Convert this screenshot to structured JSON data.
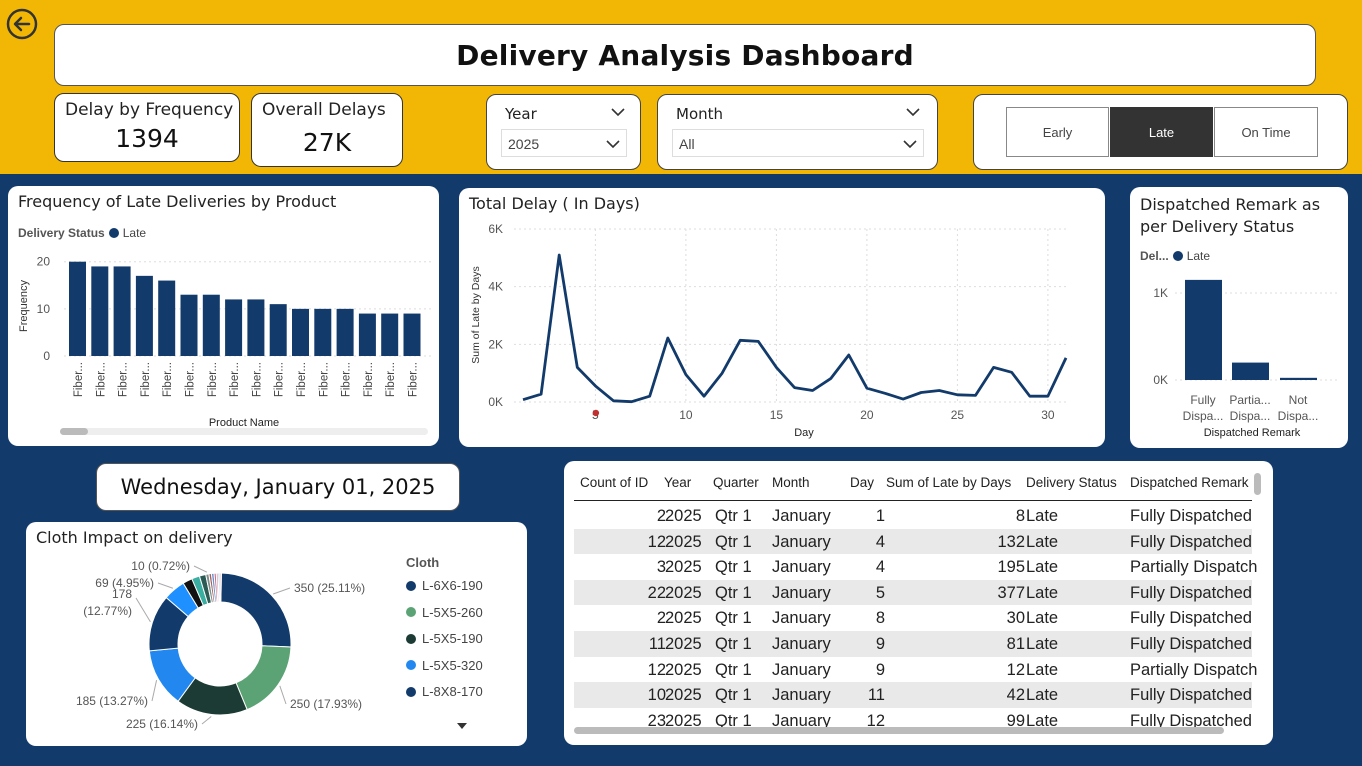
{
  "header": {
    "title": "Delivery Analysis Dashboard"
  },
  "kpis": [
    {
      "label": "Delay by Frequency",
      "value": "1394"
    },
    {
      "label": "Overall Delays",
      "value": "27K"
    }
  ],
  "filters": {
    "year": {
      "label": "Year",
      "value": "2025"
    },
    "month": {
      "label": "Month",
      "value": "All"
    }
  },
  "status_toggle": {
    "options": [
      "Early",
      "Late",
      "On Time"
    ],
    "selected": "Late"
  },
  "colors": {
    "header_bg": "#f2b705",
    "page_bg": "#123a6b",
    "series": "#123a6b",
    "active_toggle": "#333333"
  },
  "freq_chart": {
    "title": "Frequency of Late Deliveries by Product",
    "legend_title": "Delivery Status",
    "legend_item": "Late",
    "xlabel": "Product Name",
    "ylabel": "Frequency"
  },
  "delay_chart": {
    "title": "Total Delay ( In Days)",
    "xlabel": "Day",
    "ylabel": "Sum of Late by Days"
  },
  "remark_chart": {
    "title_line1": "Dispatched Remark as",
    "title_line2": "per Delivery Status",
    "legend_title": "Del...",
    "legend_item": "Late",
    "xlabel": "Dispatched Remark"
  },
  "date_display": "Wednesday, January 01, 2025",
  "cloth_chart": {
    "title": "Cloth Impact on delivery",
    "legend_title": "Cloth",
    "legend": [
      {
        "name": "L-6X6-190",
        "color": "#123a6b"
      },
      {
        "name": "L-5X5-260",
        "color": "#5ba374"
      },
      {
        "name": "L-5X5-190",
        "color": "#1c3b34"
      },
      {
        "name": "L-5X5-320",
        "color": "#2288f0"
      },
      {
        "name": "L-8X8-170",
        "color": "#123a6b"
      }
    ]
  },
  "table": {
    "columns": [
      "Count of ID",
      "Year",
      "Quarter",
      "Month",
      "Day",
      "Sum of Late by Days",
      "Delivery Status",
      "Dispatched Remark"
    ],
    "rows": [
      [
        "2",
        "2025",
        "Qtr 1",
        "January",
        "1",
        "8",
        "Late",
        "Fully Dispatched"
      ],
      [
        "12",
        "2025",
        "Qtr 1",
        "January",
        "4",
        "132",
        "Late",
        "Fully Dispatched"
      ],
      [
        "3",
        "2025",
        "Qtr 1",
        "January",
        "4",
        "195",
        "Late",
        "Partially Dispatch"
      ],
      [
        "22",
        "2025",
        "Qtr 1",
        "January",
        "5",
        "377",
        "Late",
        "Fully Dispatched"
      ],
      [
        "2",
        "2025",
        "Qtr 1",
        "January",
        "8",
        "30",
        "Late",
        "Fully Dispatched"
      ],
      [
        "11",
        "2025",
        "Qtr 1",
        "January",
        "9",
        "81",
        "Late",
        "Fully Dispatched"
      ],
      [
        "12",
        "2025",
        "Qtr 1",
        "January",
        "9",
        "12",
        "Late",
        "Partially Dispatch"
      ],
      [
        "10",
        "2025",
        "Qtr 1",
        "January",
        "11",
        "42",
        "Late",
        "Fully Dispatched"
      ],
      [
        "23",
        "2025",
        "Qtr 1",
        "January",
        "12",
        "99",
        "Late",
        "Fully Dispatched"
      ]
    ]
  },
  "chart_data": [
    {
      "type": "bar",
      "title": "Frequency of Late Deliveries by Product",
      "xlabel": "Product Name",
      "ylabel": "Frequency",
      "ylim": [
        0,
        21
      ],
      "yticks": [
        "0",
        "10",
        "20"
      ],
      "categories": [
        "Fiber...",
        "Fiber...",
        "Fiber...",
        "Fiber...",
        "Fiber...",
        "Fiber...",
        "Fiber...",
        "Fiber...",
        "Fiber...",
        "Fiber...",
        "Fiber...",
        "Fiber...",
        "Fiber...",
        "Fiber...",
        "Fiber...",
        "Fiber...",
        "Fiber..."
      ],
      "series": [
        {
          "name": "Late",
          "values": [
            20,
            19,
            19,
            17,
            16,
            13,
            13,
            12,
            12,
            11,
            10,
            10,
            10,
            9,
            9,
            9,
            0
          ]
        }
      ]
    },
    {
      "type": "line",
      "title": "Total Delay ( In Days)",
      "xlabel": "Day",
      "ylabel": "Sum of Late by Days",
      "ylim": [
        0,
        6000
      ],
      "yticks": [
        "0K",
        "2K",
        "4K",
        "6K"
      ],
      "xticks": [
        "5",
        "10",
        "15",
        "20",
        "25",
        "30"
      ],
      "x": [
        1,
        2,
        3,
        4,
        5,
        6,
        7,
        8,
        9,
        10,
        11,
        12,
        13,
        14,
        15,
        16,
        17,
        18,
        19,
        20,
        21,
        22,
        23,
        24,
        25,
        26,
        27,
        28,
        29,
        30,
        31
      ],
      "series": [
        {
          "name": "Late",
          "values": [
            80,
            270,
            5100,
            1200,
            560,
            40,
            10,
            200,
            2220,
            950,
            200,
            1000,
            2140,
            2100,
            1200,
            500,
            400,
            810,
            1630,
            480,
            300,
            100,
            330,
            400,
            250,
            230,
            1200,
            1030,
            200,
            200,
            1530
          ]
        }
      ]
    },
    {
      "type": "bar",
      "title": "Dispatched Remark as per Delivery Status",
      "xlabel": "Dispatched Remark",
      "ylim": [
        0,
        1700
      ],
      "yticks": [
        "0K",
        "1K"
      ],
      "categories": [
        "Fully Dispa...",
        "Partia... Dispa...",
        "Not Dispa..."
      ],
      "series": [
        {
          "name": "Late",
          "values": [
            1150,
            200,
            25
          ]
        }
      ]
    },
    {
      "type": "pie",
      "title": "Cloth Impact on delivery",
      "donut": true,
      "slices": [
        {
          "label": "350 (25.11%)",
          "value": 350,
          "color": "#123a6b"
        },
        {
          "label": "250 (17.93%)",
          "value": 250,
          "color": "#5ba374"
        },
        {
          "label": "225 (16.14%)",
          "value": 225,
          "color": "#1c3b34"
        },
        {
          "label": "185 (13.27%)",
          "value": 185,
          "color": "#2288f0"
        },
        {
          "label": "178 (12.77%)",
          "value": 178,
          "color": "#123a6b"
        },
        {
          "label": "69 (4.95%)",
          "value": 69,
          "color": "#1e90ff"
        },
        {
          "label": "",
          "value": 30,
          "color": "#111111"
        },
        {
          "label": "",
          "value": 25,
          "color": "#3aaea0"
        },
        {
          "label": "",
          "value": 20,
          "color": "#2c5a55"
        },
        {
          "label": "10 (0.72%)",
          "value": 10,
          "color": "#7e8e8a"
        },
        {
          "label": "",
          "value": 8,
          "color": "#a36060"
        },
        {
          "label": "",
          "value": 8,
          "color": "#6a8fc9"
        },
        {
          "label": "",
          "value": 7,
          "color": "#c07090"
        },
        {
          "label": "",
          "value": 6,
          "color": "#e0a0b0"
        },
        {
          "label": "",
          "value": 5,
          "color": "#88aacc"
        },
        {
          "label": "",
          "value": 5,
          "color": "#f0c0c8"
        }
      ]
    }
  ]
}
